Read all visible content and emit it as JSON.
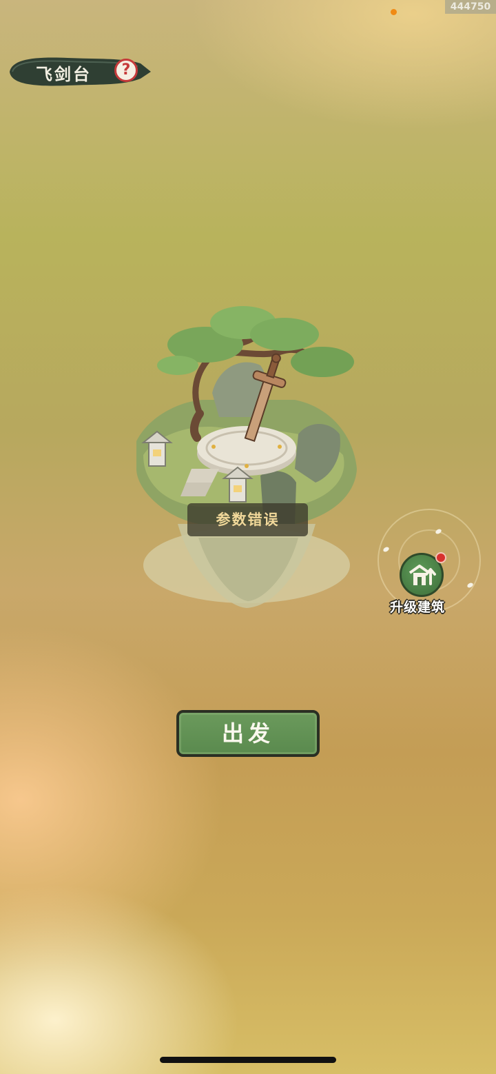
{
  "header": {
    "id_tag": "444750",
    "title": "飞剑台",
    "help_symbol": "?"
  },
  "building": {
    "status_label": "参数错误"
  },
  "upgrade": {
    "label": "升级建筑",
    "has_notification": true
  },
  "actions": {
    "depart_label": "出发"
  },
  "colors": {
    "banner": "#2f3f33",
    "help_ring": "#c63a3a",
    "button_green": "#5a8a4e",
    "notification": "#d8322e"
  },
  "icons": [
    "help-icon",
    "upgrade-building-icon",
    "notification-badge-icon"
  ]
}
